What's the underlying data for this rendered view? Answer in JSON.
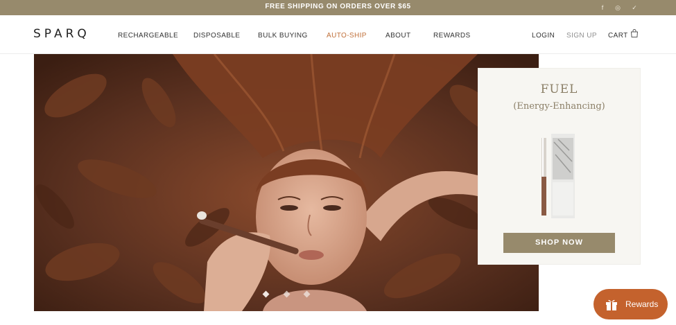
{
  "announcement": {
    "text": "FREE SHIPPING ON ORDERS OVER $65"
  },
  "social": [
    {
      "icon": "facebook-icon",
      "glyph": "f"
    },
    {
      "icon": "instagram-icon",
      "glyph": "◎"
    },
    {
      "icon": "twitter-icon",
      "glyph": "✓"
    }
  ],
  "brand": {
    "logo": "SPARQ"
  },
  "nav": {
    "items": [
      "RECHARGEABLE",
      "DISPOSABLE",
      "BULK BUYING",
      "AUTO-SHIP",
      "ABOUT",
      "REWARDS"
    ],
    "accent_item": "AUTO-SHIP"
  },
  "account": {
    "login": "LOGIN",
    "signup": "SIGN UP",
    "cart": "CART"
  },
  "hero": {
    "slides_count": 3,
    "active_slide": 1,
    "product_card": {
      "name": "FUEL",
      "subtitle": "(Energy-Enhancing)",
      "cta": "SHOP NOW"
    }
  },
  "rewards_widget": {
    "label": "Rewards"
  },
  "colors": {
    "brand_taupe": "#978a6c",
    "accent_orange": "#c0703a",
    "rewards_orange": "#c4622d",
    "card_bg": "#f7f6f2"
  }
}
